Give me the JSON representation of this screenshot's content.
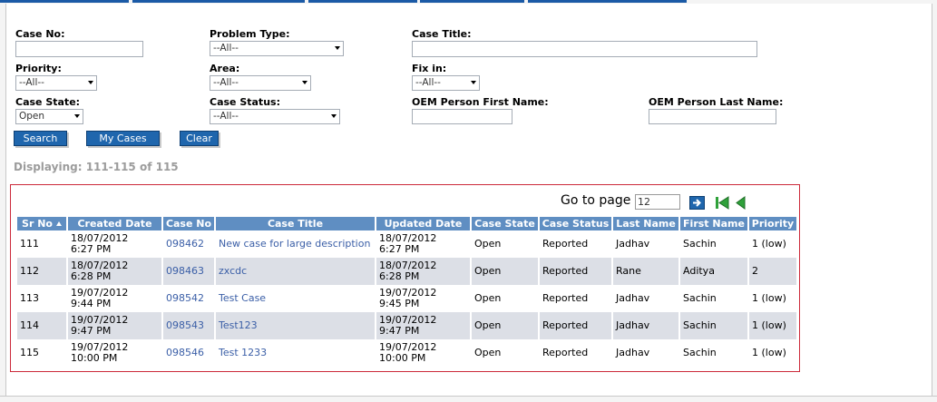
{
  "filters": {
    "case_no": {
      "label": "Case No:",
      "value": ""
    },
    "problem_type": {
      "label": "Problem Type:",
      "value": "--All--"
    },
    "case_title": {
      "label": "Case Title:",
      "value": ""
    },
    "priority": {
      "label": "Priority:",
      "value": "--All--"
    },
    "area": {
      "label": "Area:",
      "value": "--All--"
    },
    "fix_in": {
      "label": "Fix in:",
      "value": "--All--"
    },
    "case_state": {
      "label": "Case State:",
      "value": "Open"
    },
    "case_status": {
      "label": "Case Status:",
      "value": "--All--"
    },
    "oem_first": {
      "label": "OEM Person First Name:",
      "value": ""
    },
    "oem_last": {
      "label": "OEM Person Last Name:",
      "value": ""
    }
  },
  "buttons": {
    "search": "Search",
    "my_cases": "My Cases",
    "clear": "Clear"
  },
  "displaying": "Displaying: 111-115 of 115",
  "pager": {
    "label": "Go to page",
    "page": "12"
  },
  "grid": {
    "columns": [
      "Sr No",
      "Created Date",
      "Case No",
      "Case Title",
      "Updated Date",
      "Case State",
      "Case Status",
      "Last Name",
      "First Name",
      "Priority"
    ],
    "rows": [
      {
        "sr": "111",
        "created_date": "18/07/2012",
        "created_time": "6:27 PM",
        "case_no": "098462",
        "title": "New case for large description",
        "updated_date": "18/07/2012",
        "updated_time": "6:27 PM",
        "state": "Open",
        "status": "Reported",
        "last": "Jadhav",
        "first": "Sachin",
        "priority": "1 (low)"
      },
      {
        "sr": "112",
        "created_date": "18/07/2012",
        "created_time": "6:28 PM",
        "case_no": "098463",
        "title": "zxcdc",
        "updated_date": "18/07/2012",
        "updated_time": "6:28 PM",
        "state": "Open",
        "status": "Reported",
        "last": "Rane",
        "first": "Aditya",
        "priority": "2"
      },
      {
        "sr": "113",
        "created_date": "19/07/2012",
        "created_time": "9:44 PM",
        "case_no": "098542",
        "title": "Test Case",
        "updated_date": "19/07/2012",
        "updated_time": "9:45 PM",
        "state": "Open",
        "status": "Reported",
        "last": "Jadhav",
        "first": "Sachin",
        "priority": "1 (low)"
      },
      {
        "sr": "114",
        "created_date": "19/07/2012",
        "created_time": "9:47 PM",
        "case_no": "098543",
        "title": "Test123",
        "updated_date": "19/07/2012",
        "updated_time": "9:47 PM",
        "state": "Open",
        "status": "Reported",
        "last": "Jadhav",
        "first": "Sachin",
        "priority": "1 (low)"
      },
      {
        "sr": "115",
        "created_date": "19/07/2012",
        "created_time": "10:00 PM",
        "case_no": "098546",
        "title": "Test 1233",
        "updated_date": "19/07/2012",
        "updated_time": "10:00 PM",
        "state": "Open",
        "status": "Reported",
        "last": "Jadhav",
        "first": "Sachin",
        "priority": "1 (low)"
      }
    ]
  },
  "colors": {
    "accent": "#1f66ad",
    "header": "#5f8ec2",
    "alt_row": "#dcdfe6",
    "grid_border": "#cc2a3a",
    "link": "#3b5fa7"
  },
  "icons": {
    "go": "arrow-right-icon",
    "first": "first-page-icon",
    "prev": "previous-page-icon",
    "sort": "sort-ascending-icon"
  }
}
